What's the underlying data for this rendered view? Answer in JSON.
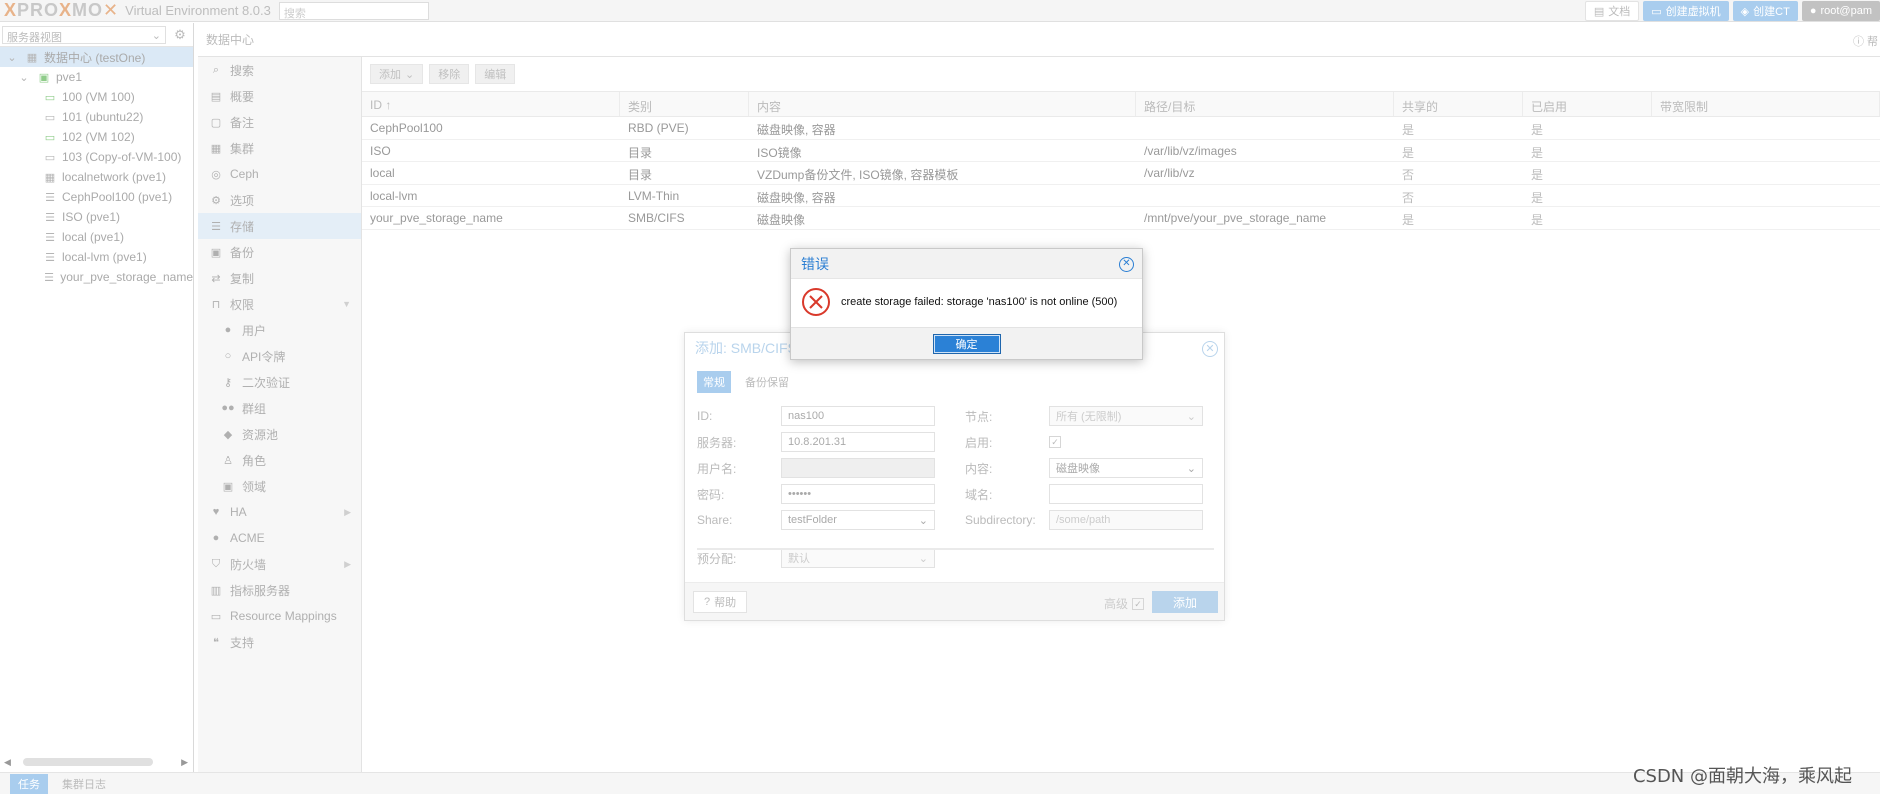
{
  "topbar": {
    "logo_a": "PRO",
    "logo_x1": "X",
    "logo_mo": "MO",
    "logo_x2": "X",
    "version": "Virtual Environment 8.0.3",
    "search_placeholder": "搜索",
    "docs": "文档",
    "create_vm": "创建虚拟机",
    "create_ct": "创建CT",
    "user": "root@pam"
  },
  "tree": {
    "view_label": "服务器视图",
    "items": [
      {
        "label": "数据中心 (testOne)"
      },
      {
        "label": "pve1"
      },
      {
        "label": "100 (VM 100)"
      },
      {
        "label": "101 (ubuntu22)"
      },
      {
        "label": "102 (VM 102)"
      },
      {
        "label": "103 (Copy-of-VM-100)"
      },
      {
        "label": "localnetwork (pve1)"
      },
      {
        "label": "CephPool100 (pve1)"
      },
      {
        "label": "ISO (pve1)"
      },
      {
        "label": "local (pve1)"
      },
      {
        "label": "local-lvm (pve1)"
      },
      {
        "label": "your_pve_storage_name"
      }
    ]
  },
  "center": {
    "title": "数据中心",
    "help": "帮"
  },
  "nav": [
    {
      "label": "搜索"
    },
    {
      "label": "概要"
    },
    {
      "label": "备注"
    },
    {
      "label": "集群"
    },
    {
      "label": "Ceph"
    },
    {
      "label": "选项"
    },
    {
      "label": "存储"
    },
    {
      "label": "备份"
    },
    {
      "label": "复制"
    },
    {
      "label": "权限"
    },
    {
      "label": "用户"
    },
    {
      "label": "API令牌"
    },
    {
      "label": "二次验证"
    },
    {
      "label": "群组"
    },
    {
      "label": "资源池"
    },
    {
      "label": "角色"
    },
    {
      "label": "领域"
    },
    {
      "label": "HA"
    },
    {
      "label": "ACME"
    },
    {
      "label": "防火墙"
    },
    {
      "label": "指标服务器"
    },
    {
      "label": "Resource Mappings"
    },
    {
      "label": "支持"
    }
  ],
  "toolbar": {
    "add": "添加",
    "remove": "移除",
    "edit": "编辑"
  },
  "grid": {
    "headers": [
      "ID ↑",
      "类别",
      "内容",
      "路径/目标",
      "共享的",
      "已启用",
      "带宽限制"
    ],
    "rows": [
      [
        "CephPool100",
        "RBD (PVE)",
        "磁盘映像, 容器",
        "",
        "是",
        "是",
        ""
      ],
      [
        "ISO",
        "目录",
        "ISO镜像",
        "/var/lib/vz/images",
        "是",
        "是",
        ""
      ],
      [
        "local",
        "目录",
        "VZDump备份文件, ISO镜像, 容器模板",
        "/var/lib/vz",
        "否",
        "是",
        ""
      ],
      [
        "local-lvm",
        "LVM-Thin",
        "磁盘映像, 容器",
        "",
        "否",
        "是",
        ""
      ],
      [
        "your_pve_storage_name",
        "SMB/CIFS",
        "磁盘映像",
        "/mnt/pve/your_pve_storage_name",
        "是",
        "是",
        ""
      ]
    ]
  },
  "add_dialog": {
    "title": "添加: SMB/CIFS",
    "tab_general": "常规",
    "tab_backup": "备份保留",
    "labels": {
      "id": "ID:",
      "server": "服务器:",
      "username": "用户名:",
      "password": "密码:",
      "share": "Share:",
      "node": "节点:",
      "enable": "启用:",
      "content": "内容:",
      "domain": "域名:",
      "subdir": "Subdirectory:",
      "prealloc": "预分配:"
    },
    "values": {
      "id": "nas100",
      "server": "10.8.201.31",
      "password": "••••••",
      "share": "testFolder",
      "node": "所有 (无限制)",
      "content": "磁盘映像",
      "subdir": "/some/path",
      "prealloc": "默认"
    },
    "help": "帮助",
    "advanced": "高级",
    "add": "添加"
  },
  "error_dialog": {
    "title": "错误",
    "message": "create storage failed: storage 'nas100' is not online (500)",
    "ok": "确定"
  },
  "bottom": {
    "tab_tasks": "任务",
    "tab_log": "集群日志"
  },
  "watermark": "CSDN @面朝大海，乘风起"
}
